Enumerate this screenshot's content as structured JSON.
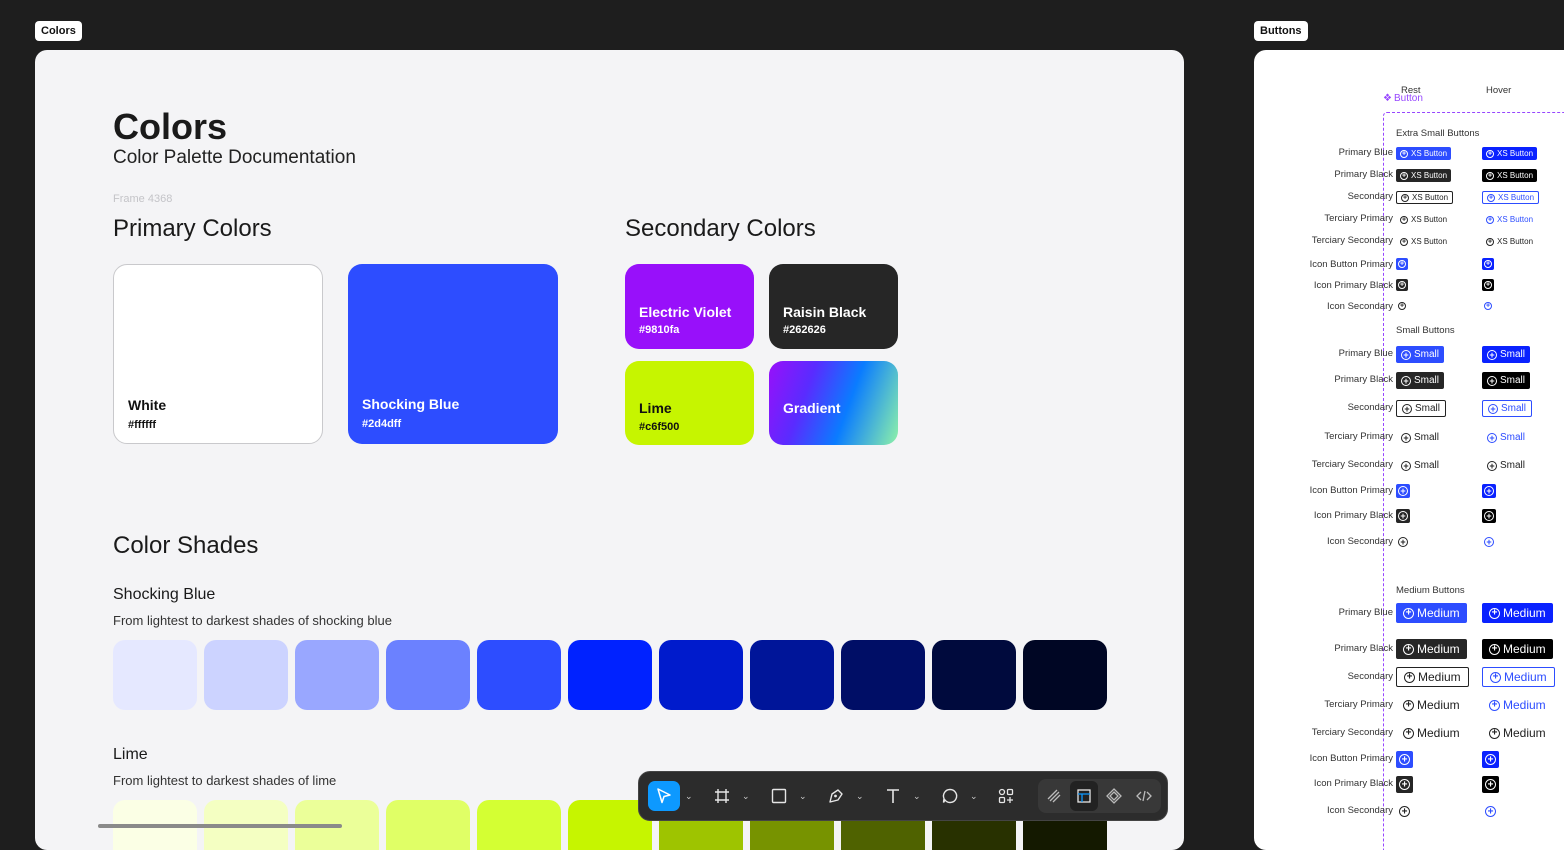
{
  "frames": {
    "colors_tag": "Colors",
    "buttons_tag": "Buttons"
  },
  "colors_page": {
    "title": "Colors",
    "subtitle": "Color Palette Documentation",
    "frame_label": "Frame 4368",
    "primary_heading": "Primary Colors",
    "secondary_heading": "Secondary Colors",
    "primary": [
      {
        "name": "White",
        "hex": "#ffffff",
        "color": "#ffffff"
      },
      {
        "name": "Shocking Blue",
        "hex": "#2d4dff",
        "color": "#2d4dff"
      }
    ],
    "secondary": [
      {
        "name": "Electric Violet",
        "hex": "#9810fa",
        "color": "#9810fa"
      },
      {
        "name": "Raisin Black",
        "hex": "#262626",
        "color": "#262626"
      },
      {
        "name": "Lime",
        "hex": "#c6f500",
        "color": "#c6f500"
      },
      {
        "name": "Gradient",
        "hex": "",
        "color": "gradient"
      }
    ],
    "shades_heading": "Color Shades",
    "shades": [
      {
        "name": "Shocking Blue",
        "description": "From lightest to darkest shades of shocking blue",
        "colors": [
          "#e5e8ff",
          "#ccd3ff",
          "#99a7ff",
          "#6b81ff",
          "#2d4dff",
          "#0022ff",
          "#001bcc",
          "#001599",
          "#000e66",
          "#000a3d",
          "#000624"
        ]
      },
      {
        "name": "Lime",
        "description": "From lightest to darkest shades of lime",
        "colors": [
          "#fbffe5",
          "#f4ffc2",
          "#ebff99",
          "#e0ff66",
          "#d4ff33",
          "#c6f500",
          "#9ec400",
          "#779300",
          "#4f6200",
          "#283100",
          "#141900"
        ]
      }
    ]
  },
  "buttons_page": {
    "component_label": "Button",
    "col_rest": "Rest",
    "col_hover": "Hover",
    "xs_group": "Extra Small Buttons",
    "small_group": "Small Buttons",
    "medium_group": "Medium Buttons",
    "xs_label": "XS Button",
    "small_label": "Small",
    "medium_label": "Medium",
    "rows": {
      "primary_blue": "Primary Blue",
      "primary_black": "Primary Black",
      "secondary": "Secondary",
      "terciary_primary": "Terciary Primary",
      "terciary_secondary": "Terciary Secondary",
      "icon_button_primary": "Icon Button Primary",
      "icon_primary_black": "Icon Primary Black",
      "icon_secondary": "Icon Secondary"
    }
  },
  "toolbar": {
    "tools": [
      "move-tool",
      "frame-tool",
      "shape-tool",
      "pen-tool",
      "text-tool",
      "comment-tool",
      "actions-tool",
      "draw-mode",
      "design-mode",
      "prototype-mode",
      "dev-mode"
    ],
    "active": "move-tool",
    "accent": "#0d99ff"
  }
}
